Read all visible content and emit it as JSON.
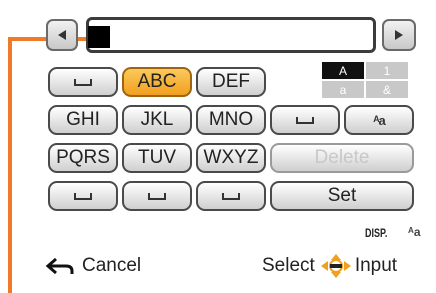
{
  "keys": {
    "abc": "ABC",
    "def": "DEF",
    "ghi": "GHI",
    "jkl": "JKL",
    "mno": "MNO",
    "pqrs": "PQRS",
    "tuv": "TUV",
    "wxyz": "WXYZ",
    "delete": "Delete",
    "set": "Set"
  },
  "mode_indicator": {
    "upper": "A",
    "digit": "1",
    "lower": "a",
    "symbol": "&"
  },
  "footer": {
    "cancel": "Cancel",
    "select_input": "Select",
    "input": "Input",
    "disp": "DISP."
  },
  "colors": {
    "callout": "#f07a2a",
    "active_key": "#f0a020",
    "selected_mode": "#111111"
  }
}
